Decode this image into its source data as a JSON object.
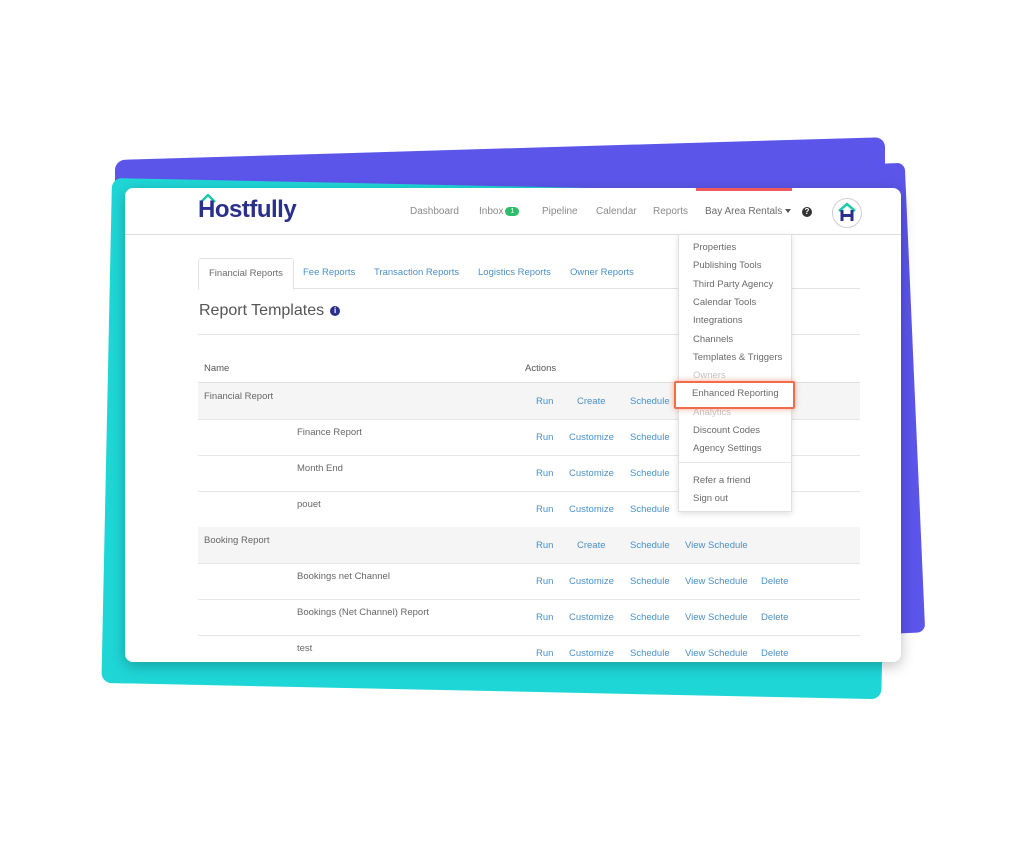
{
  "app": {
    "logo_text": "Hostfully"
  },
  "nav": {
    "items": [
      "Dashboard",
      "Inbox",
      "Pipeline",
      "Calendar",
      "Reports"
    ],
    "inbox_badge": "1",
    "account_menu": "Bay Area Rentals",
    "help_icon": "question-circle-icon",
    "avatar_icon": "house-h-icon"
  },
  "tabs": [
    "Financial Reports",
    "Fee Reports",
    "Transaction Reports",
    "Logistics Reports",
    "Owner Reports"
  ],
  "page": {
    "title": "Report Templates"
  },
  "table": {
    "headers": {
      "name": "Name",
      "actions": "Actions"
    },
    "rows": [
      {
        "type": "group",
        "name": "Financial Report",
        "actions": [
          "Run",
          "Create",
          "Schedule"
        ]
      },
      {
        "type": "item",
        "name": "Finance Report",
        "actions": [
          "Run",
          "Customize",
          "Schedule"
        ]
      },
      {
        "type": "item",
        "name": "Month End",
        "actions": [
          "Run",
          "Customize",
          "Schedule"
        ]
      },
      {
        "type": "item",
        "name": "pouet",
        "actions": [
          "Run",
          "Customize",
          "Schedule"
        ]
      },
      {
        "type": "group",
        "name": "Booking Report",
        "actions": [
          "Run",
          "Create",
          "Schedule",
          "View Schedule"
        ]
      },
      {
        "type": "item",
        "name": "Bookings net Channel",
        "actions": [
          "Run",
          "Customize",
          "Schedule",
          "View Schedule",
          "Delete"
        ]
      },
      {
        "type": "item",
        "name": "Bookings (Net Channel) Report",
        "actions": [
          "Run",
          "Customize",
          "Schedule",
          "View Schedule",
          "Delete"
        ]
      },
      {
        "type": "item",
        "name": "test",
        "actions": [
          "Run",
          "Customize",
          "Schedule",
          "View Schedule",
          "Delete"
        ]
      }
    ]
  },
  "dropdown": {
    "items": [
      "Properties",
      "Publishing Tools",
      "Third Party Agency",
      "Calendar Tools",
      "Integrations",
      "Channels",
      "Templates & Triggers",
      "Owners",
      "Enhanced Reporting",
      "Analytics",
      "Discount Codes",
      "Agency Settings",
      "Refer a friend",
      "Sign out"
    ],
    "highlighted": "Enhanced Reporting"
  },
  "colors": {
    "brand": "#2b2f8c",
    "link": "#4a90c8",
    "highlight": "#f26b4b",
    "accent_purple": "#5b55ea",
    "accent_teal": "#1fd6d6"
  }
}
